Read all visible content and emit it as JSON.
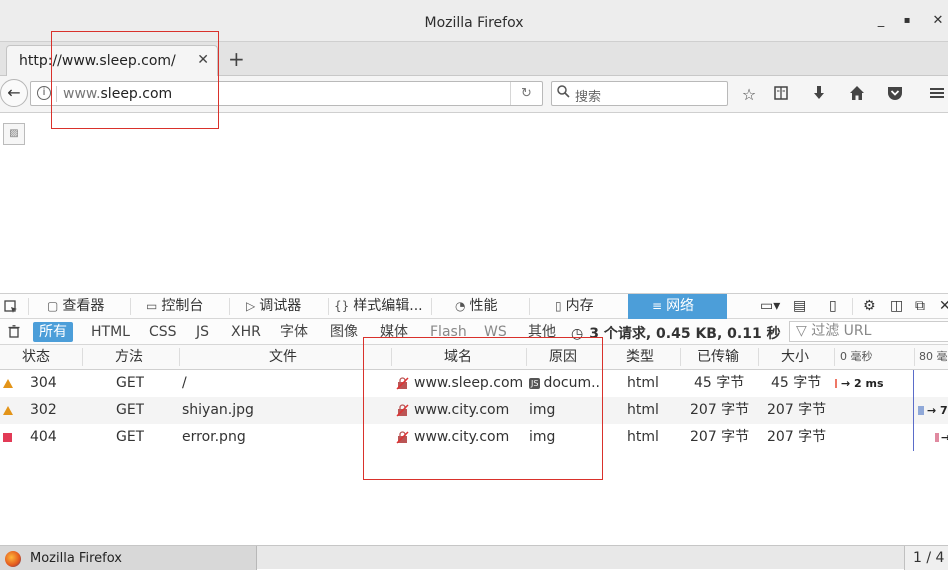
{
  "window": {
    "title": "Mozilla Firefox",
    "minimize": "_",
    "maximize": "▪",
    "close": "✕"
  },
  "tab": {
    "label": "http://www.sleep.com/",
    "close": "✕",
    "new_tab": "+"
  },
  "navbar": {
    "back": "←",
    "url_prefix": "www.",
    "url_domain": "sleep.com",
    "reload": "↻",
    "search_placeholder": "搜索"
  },
  "devtools": {
    "tools": [
      {
        "label": "查看器",
        "icon": "inspector-icon"
      },
      {
        "label": "控制台",
        "icon": "console-icon"
      },
      {
        "label": "调试器",
        "icon": "debugger-icon"
      },
      {
        "label": "样式编辑...",
        "icon": "style-editor-icon"
      },
      {
        "label": "性能",
        "icon": "performance-icon"
      },
      {
        "label": "内存",
        "icon": "memory-icon"
      },
      {
        "label": "网络",
        "icon": "network-icon"
      }
    ],
    "filters": [
      "所有",
      "HTML",
      "CSS",
      "JS",
      "XHR",
      "字体",
      "图像",
      "媒体",
      "Flash",
      "WS",
      "其他"
    ],
    "summary": "3 个请求, 0.45 KB, 0.11 秒",
    "filter_url_placeholder": "过滤 URL",
    "columns": {
      "status": "状态",
      "method": "方法",
      "file": "文件",
      "domain": "域名",
      "cause": "原因",
      "type": "类型",
      "transferred": "已传输",
      "size": "大小",
      "timeline_0": "0 毫秒",
      "timeline_80": "80 毫"
    },
    "requests": [
      {
        "status": "304",
        "method": "GET",
        "file": "/",
        "domain": "www.sleep.com",
        "cause": "docum...",
        "cause_js": "JS",
        "type": "html",
        "transferred": "45 字节",
        "size": "45 字节",
        "timing": "→ 2 ms",
        "status_color": "#e39418"
      },
      {
        "status": "302",
        "method": "GET",
        "file": "shiyan.jpg",
        "domain": "www.city.com",
        "cause": "img",
        "cause_js": "",
        "type": "html",
        "transferred": "207 字节",
        "size": "207 字节",
        "timing": "→ 7",
        "status_color": "#e39418"
      },
      {
        "status": "404",
        "method": "GET",
        "file": "error.png",
        "domain": "www.city.com",
        "cause": "img",
        "cause_js": "",
        "type": "html",
        "transferred": "207 字节",
        "size": "207 字节",
        "timing": "→",
        "status_color": "#e23a56"
      }
    ]
  },
  "statusbar": {
    "task_label": "Mozilla Firefox",
    "pager": "1 / 4"
  }
}
